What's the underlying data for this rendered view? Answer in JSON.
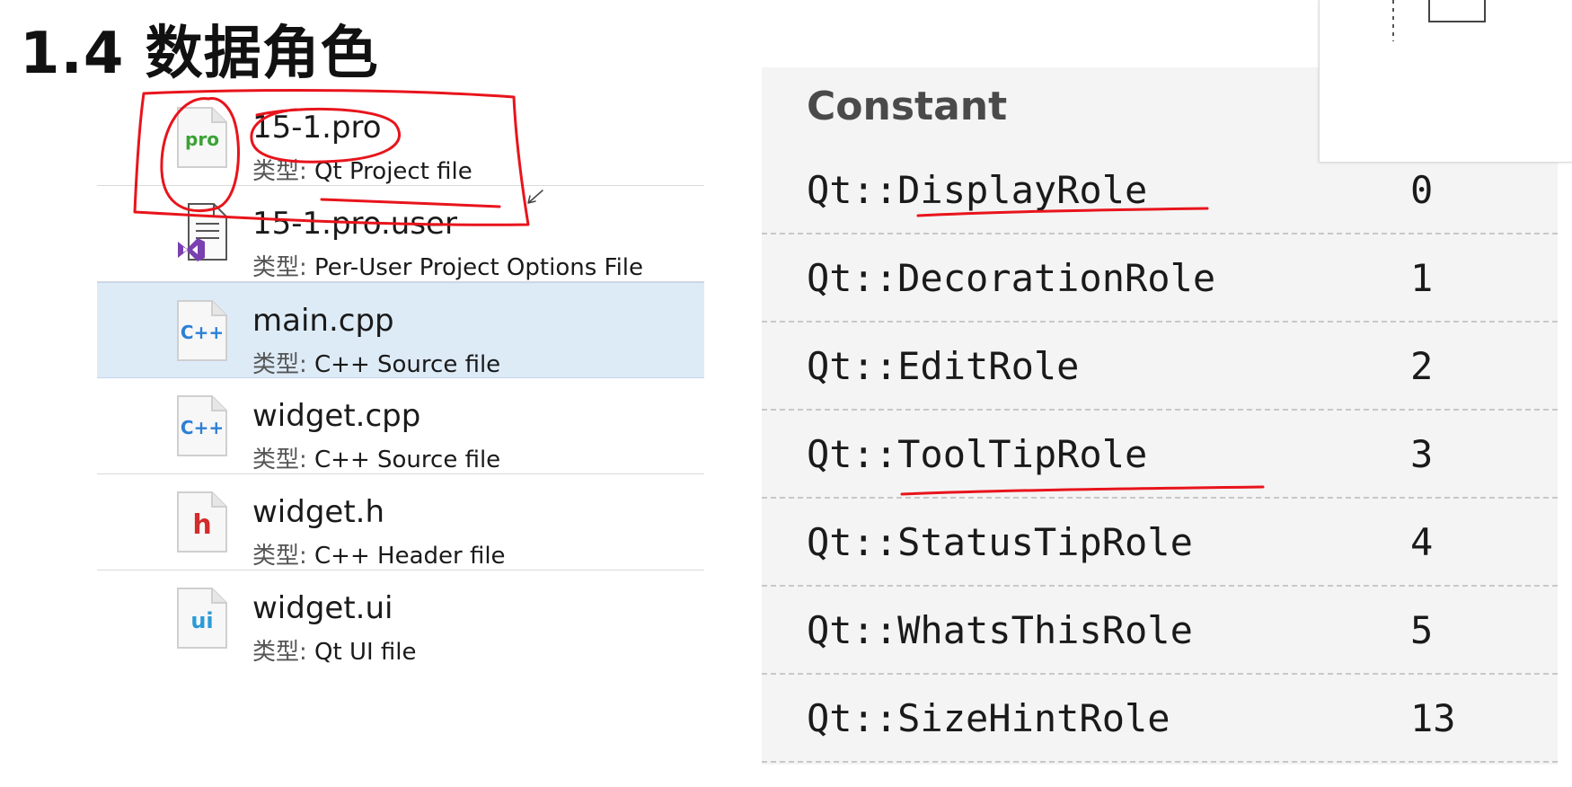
{
  "slide": {
    "title": "1.4 数据角色"
  },
  "files": [
    {
      "name": "15-1.pro",
      "type_key": "类型:",
      "type_value": "Qt Project file",
      "icon": "pro-file-icon",
      "selected": false
    },
    {
      "name": "15-1.pro.user",
      "type_key": "类型:",
      "type_value": "Per-User Project Options File",
      "icon": "vs-user-file-icon",
      "selected": false
    },
    {
      "name": "main.cpp",
      "type_key": "类型:",
      "type_value": "C++ Source file",
      "icon": "cpp-file-icon",
      "selected": true
    },
    {
      "name": "widget.cpp",
      "type_key": "类型:",
      "type_value": "C++ Source file",
      "icon": "cpp-file-icon",
      "selected": false
    },
    {
      "name": "widget.h",
      "type_key": "类型:",
      "type_value": "C++ Header file",
      "icon": "header-file-icon",
      "selected": false
    },
    {
      "name": "widget.ui",
      "type_key": "类型:",
      "type_value": "Qt UI file",
      "icon": "ui-file-icon",
      "selected": false
    }
  ],
  "icon_labels": {
    "pro": "pro",
    "cpp": "C++",
    "h": "h",
    "ui": "ui"
  },
  "table": {
    "header": "Constant",
    "rows": [
      {
        "name": "Qt::DisplayRole",
        "value": "0"
      },
      {
        "name": "Qt::DecorationRole",
        "value": "1"
      },
      {
        "name": "Qt::EditRole",
        "value": "2"
      },
      {
        "name": "Qt::ToolTipRole",
        "value": "3"
      },
      {
        "name": "Qt::StatusTipRole",
        "value": "4"
      },
      {
        "name": "Qt::WhatsThisRole",
        "value": "5"
      },
      {
        "name": "Qt::SizeHintRole",
        "value": "13"
      }
    ]
  },
  "colors": {
    "selection": "#ddebf7",
    "annotation": "#e8141c",
    "pro_green": "#3aa335",
    "cpp_blue": "#2b7fd6",
    "header_red": "#d42b2b",
    "vs_purple": "#7a3fb0"
  }
}
